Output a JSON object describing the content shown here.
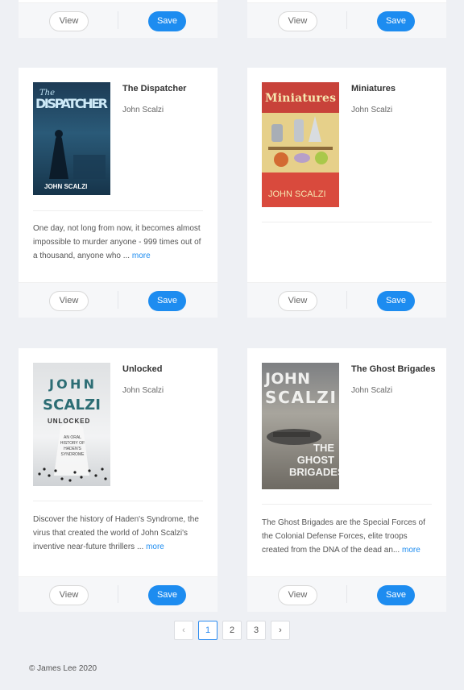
{
  "buttons": {
    "view": "View",
    "save": "Save",
    "more": "more"
  },
  "books": [
    {
      "title": "The Dispatcher",
      "author": "John Scalzi",
      "cover_title": "The DISPATCHER",
      "cover_author": "JOHN SCALZI",
      "description": "One day, not long from now, it becomes almost impossible to murder anyone - 999 times out of a thousand, anyone who ..."
    },
    {
      "title": "Miniatures",
      "author": "John Scalzi",
      "cover_title": "Miniatures",
      "cover_author": "JOHN SCALZI",
      "description": ""
    },
    {
      "title": "Unlocked",
      "author": "John Scalzi",
      "cover_title": "UNLOCKED",
      "cover_author": "JOHN SCALZI",
      "cover_sub": "AN ORAL HISTORY OF HADEN'S SYNDROME",
      "description": "Discover the history of Haden's Syndrome, the virus that created the world of John Scalzi's inventive near-future thrillers ..."
    },
    {
      "title": "The Ghost Brigades",
      "author": "John Scalzi",
      "cover_title": "THE GHOST BRIGADES",
      "cover_author": "JOHN SCALZI",
      "description": "The Ghost Brigades are the Special Forces of the Colonial Defense Forces, elite troops created from the DNA of the dead an..."
    }
  ],
  "pagination": {
    "prev": "‹",
    "next": "›",
    "pages": [
      "1",
      "2",
      "3"
    ],
    "current": "1"
  },
  "footer": "© James Lee 2020",
  "colors": {
    "accent": "#1d8cf0",
    "background": "#eef0f4"
  }
}
